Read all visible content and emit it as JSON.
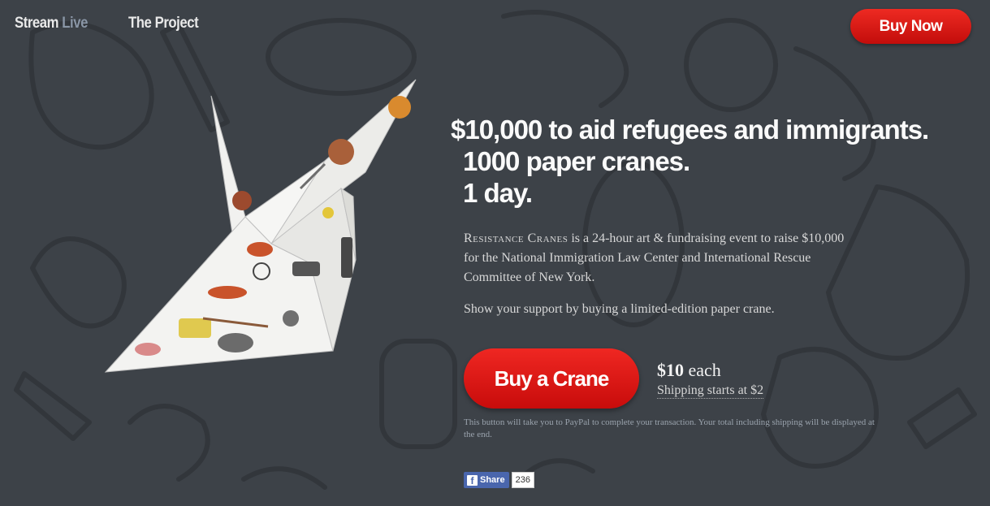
{
  "nav": {
    "stream_word": "Stream",
    "live_word": "Live",
    "project_label": "The Project"
  },
  "header": {
    "buy_now_label": "Buy Now"
  },
  "hero": {
    "line1": "$10,000 to aid refugees and immigrants.",
    "line2": "1000 paper cranes.",
    "line3": "1 day.",
    "brand_name": "Resistance Cranes",
    "description": " is a 24-hour art & fundraising event to raise $10,000 for the National Immigration Law Center and International Rescue Committee of New York.",
    "support_text": "Show your support by buying a limited-edition paper crane."
  },
  "purchase": {
    "buy_crane_label": "Buy a Crane",
    "price_amount": "$10",
    "price_unit": "each",
    "shipping_text": "Shipping starts at $2",
    "note": "This button will take you to PayPal to complete your transaction. Your total including shipping will be displayed at the end."
  },
  "social": {
    "share_label": "Share",
    "share_count": "236",
    "facebook_icon_glyph": "f"
  },
  "colors": {
    "background": "#3d4248",
    "accent_red": "#d9181a",
    "facebook_blue": "#4a66ad"
  }
}
